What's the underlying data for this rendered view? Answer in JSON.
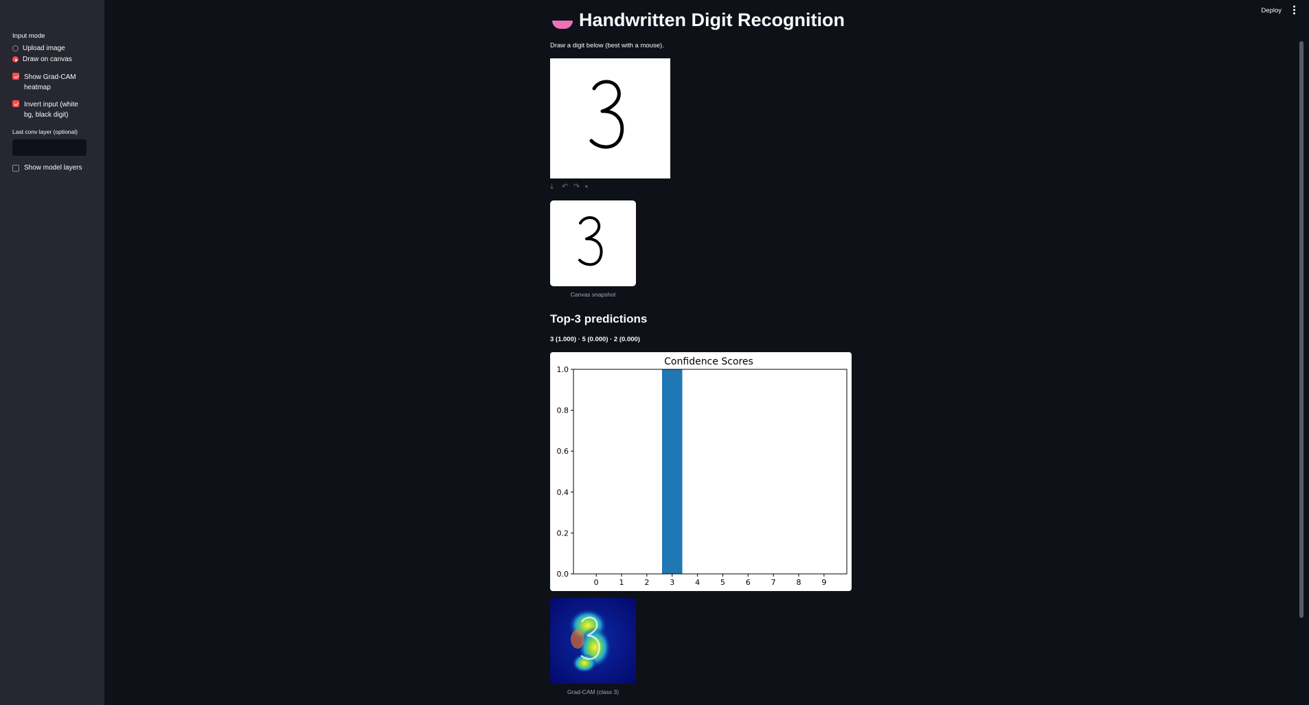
{
  "sidebar": {
    "input_mode_label": "Input mode",
    "radio_options": [
      {
        "label": "Upload image",
        "selected": false
      },
      {
        "label": "Draw on canvas",
        "selected": true
      }
    ],
    "checkboxes": [
      {
        "label": "Show Grad-CAM heatmap",
        "checked": true
      },
      {
        "label": "Invert input (white bg, black digit)",
        "checked": true
      }
    ],
    "conv_layer_label": "Last conv layer (optional)",
    "conv_layer_value": "",
    "show_layers": {
      "label": "Show model layers",
      "checked": false
    }
  },
  "header": {
    "deploy_label": "Deploy"
  },
  "main": {
    "title": "Handwritten Digit Recognition",
    "draw_caption": "Draw a digit below (best with a mouse).",
    "canvas_digit": "3",
    "snapshot_caption": "Canvas snapshot",
    "predictions_heading": "Top-3 predictions",
    "predictions_text": "3 (1.000) · 5 (0.000) · 2 (0.000)",
    "gradcam_caption": "Grad-CAM (class 3)"
  },
  "colors": {
    "accent": "#ff4b4b",
    "background": "#0e1117",
    "sidebar": "#262730",
    "bar": "#1f77b4"
  },
  "chart_data": {
    "type": "bar",
    "title": "Confidence Scores",
    "categories": [
      "0",
      "1",
      "2",
      "3",
      "4",
      "5",
      "6",
      "7",
      "8",
      "9"
    ],
    "values": [
      0.0,
      0.0,
      0.0,
      1.0,
      0.0,
      0.0,
      0.0,
      0.0,
      0.0,
      0.0
    ],
    "ylim": [
      0,
      1.0
    ],
    "yticks": [
      "0.0",
      "0.2",
      "0.4",
      "0.6",
      "0.8",
      "1.0"
    ],
    "xlabel": "",
    "ylabel": "",
    "grid": false
  }
}
